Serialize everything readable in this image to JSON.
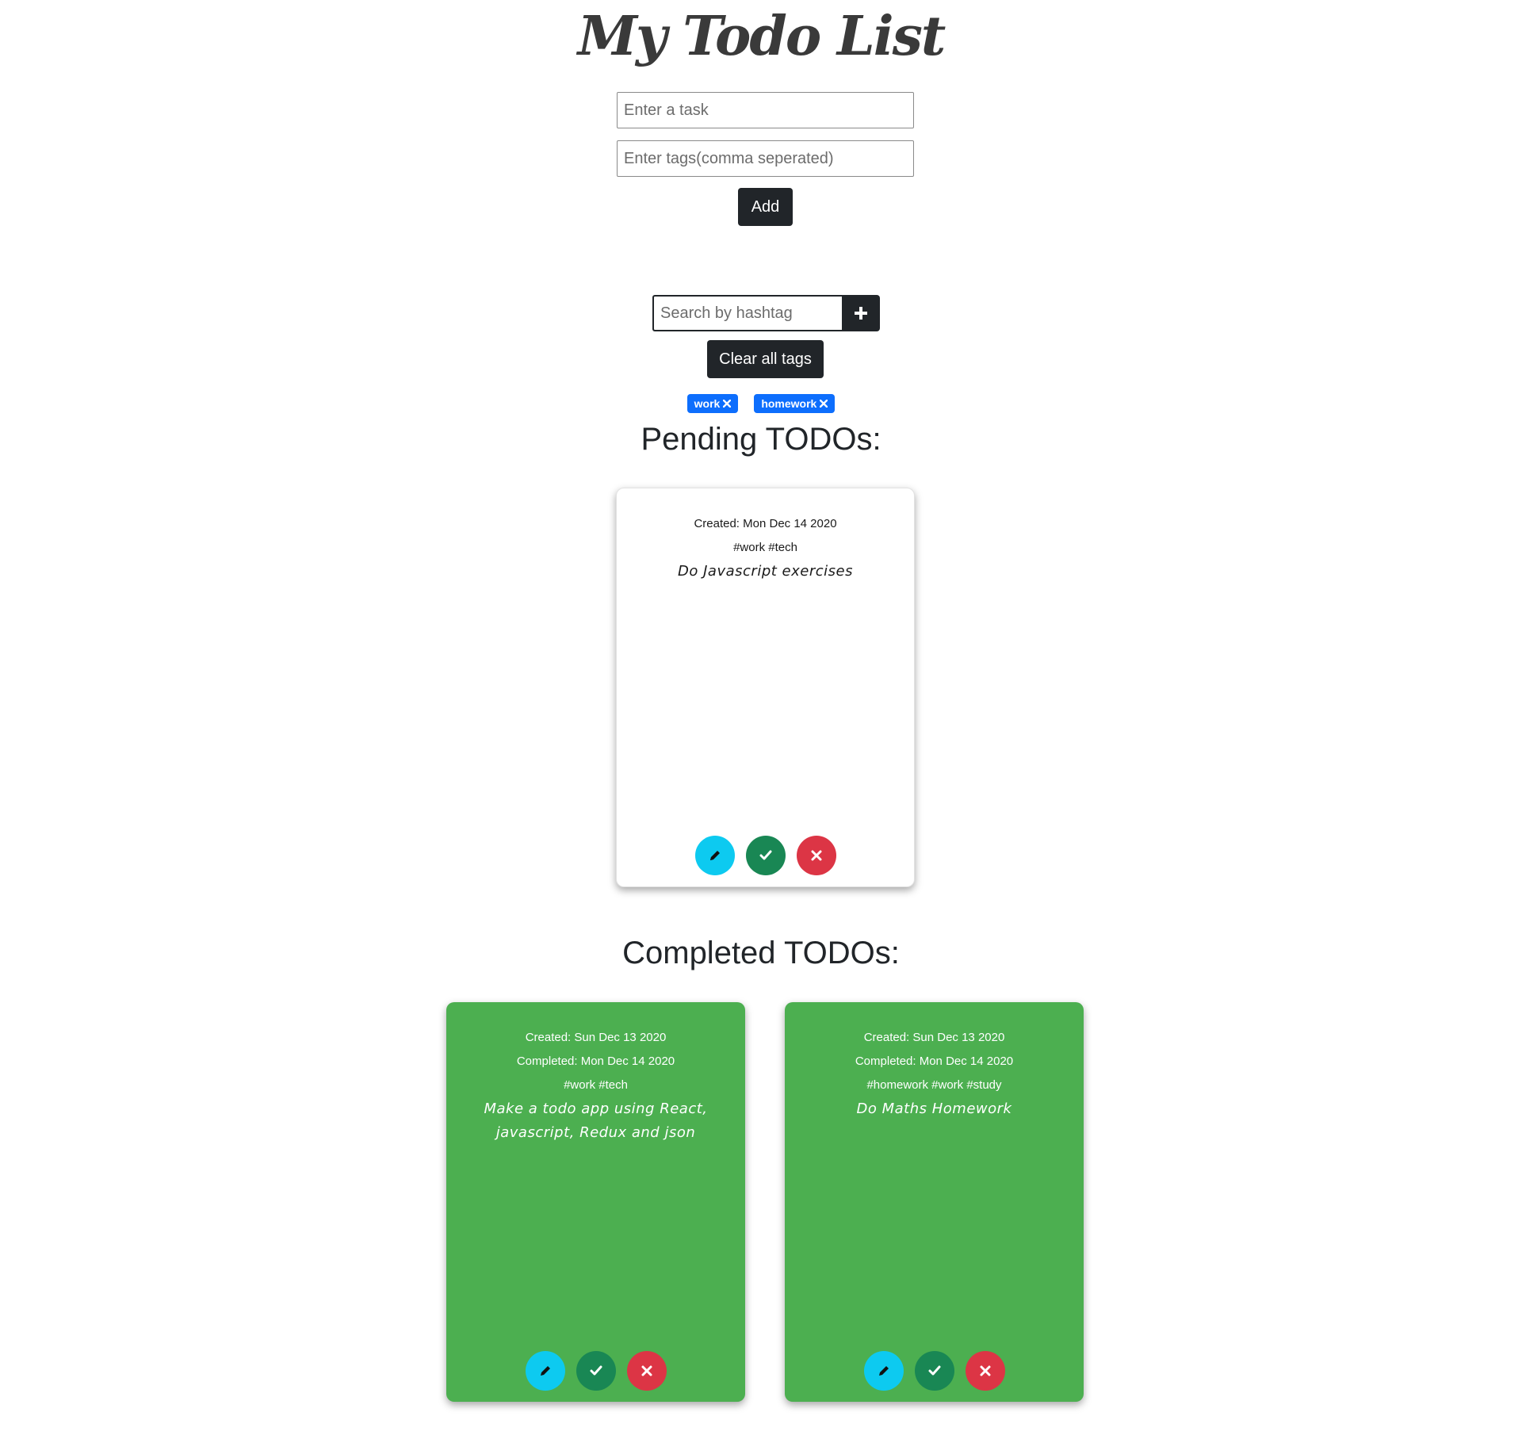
{
  "app_title": "My Todo List",
  "form": {
    "task_placeholder": "Enter a task",
    "tags_placeholder": "Enter tags(comma seperated)",
    "add_label": "Add"
  },
  "search": {
    "placeholder": "Search by hashtag",
    "clear_label": "Clear all tags",
    "active_tags": [
      "work",
      "homework"
    ]
  },
  "pending": {
    "heading": "Pending TODOs:",
    "items": [
      {
        "created": "Created: Mon Dec 14 2020",
        "tags": "#work #tech",
        "task": "Do Javascript exercises"
      }
    ]
  },
  "completed": {
    "heading": "Completed TODOs:",
    "items": [
      {
        "created": "Created: Sun Dec 13 2020",
        "completed": "Completed: Mon Dec 14 2020",
        "tags": "#work #tech",
        "task": "Make a todo app using React, javascript, Redux and json"
      },
      {
        "created": "Created: Sun Dec 13 2020",
        "completed": "Completed: Mon Dec 14 2020",
        "tags": "#homework #work #study",
        "task": "Do Maths Homework"
      }
    ]
  },
  "colors": {
    "dark": "#212529",
    "tag_blue": "#0d6efd",
    "completed_card": "#4caf50",
    "edit": "#0dcaf0",
    "complete": "#198754",
    "delete": "#dc3545"
  }
}
